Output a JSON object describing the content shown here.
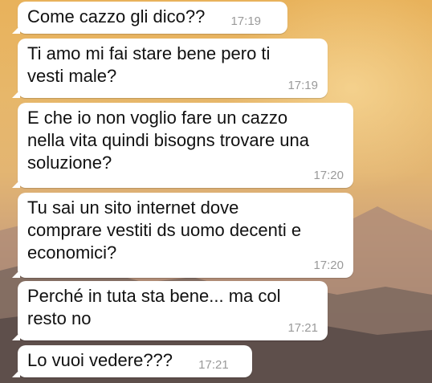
{
  "chat": {
    "messages": [
      {
        "text": "Come cazzo gli dico??",
        "time": "17:19"
      },
      {
        "text": "Ti amo mi fai stare bene pero ti\nvesti male?",
        "time": "17:19"
      },
      {
        "text": "E che io non voglio fare un cazzo\nnella vita quindi bisogns trovare una\nsoluzione?",
        "time": "17:20"
      },
      {
        "text": "Tu sai un sito internet dove\ncomprare vestiti ds uomo decenti e\neconomici?",
        "time": "17:20"
      },
      {
        "text": "Perché in tuta sta bene... ma col\nresto no",
        "time": "17:21"
      },
      {
        "text": "Lo vuoi vedere???",
        "time": "17:21"
      }
    ]
  },
  "colors": {
    "bubble_incoming": "#ffffff",
    "timestamp": "#9a9a9a",
    "wallpaper_top": "#e8b25b",
    "wallpaper_bottom": "#6f5c55"
  },
  "icons": {
    "wallpaper": "desert-mountains-wallpaper"
  }
}
